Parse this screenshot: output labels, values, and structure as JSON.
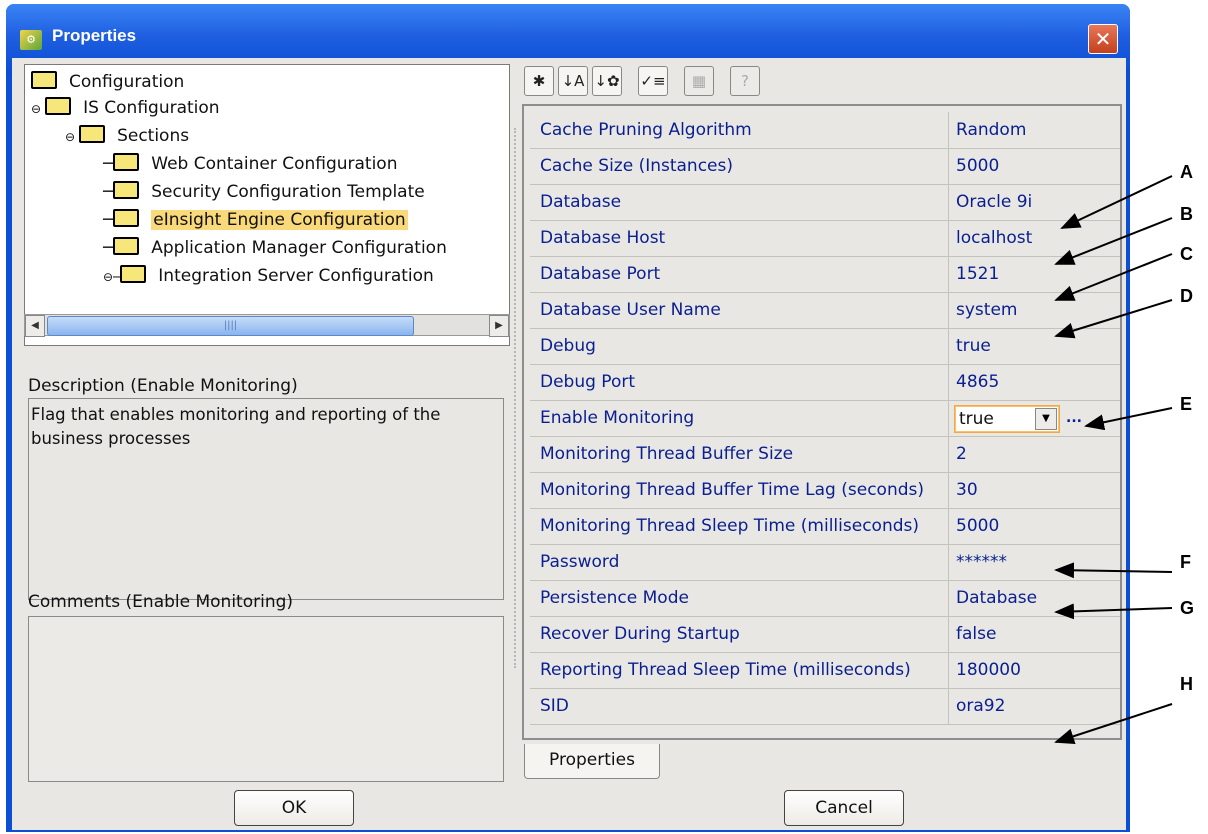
{
  "window": {
    "title": "Properties",
    "close_glyph": "✕"
  },
  "tree": {
    "nodes": [
      {
        "label": "Configuration"
      },
      {
        "label": "IS Configuration"
      },
      {
        "label": "Sections"
      },
      {
        "label": "Web Container Configuration"
      },
      {
        "label": "Security Configuration Template"
      },
      {
        "label": "eInsight Engine Configuration",
        "selected": true
      },
      {
        "label": "Application Manager Configuration"
      },
      {
        "label": "Integration Server Configuration"
      }
    ]
  },
  "description": {
    "label": "Description (Enable Monitoring)",
    "text": "Flag that enables monitoring and reporting of the business processes"
  },
  "comments": {
    "label": "Comments (Enable Monitoring)",
    "text": ""
  },
  "toolbar": {
    "icons": [
      "categorized-view-icon",
      "alphabetical-sort-icon",
      "sort-by-type-icon",
      "checklist-icon",
      "properties-grid-icon",
      "help-icon"
    ]
  },
  "properties": [
    {
      "name": "Cache Pruning Algorithm",
      "value": "Random"
    },
    {
      "name": "Cache Size (Instances)",
      "value": "5000"
    },
    {
      "name": "Database",
      "value": "Oracle 9i"
    },
    {
      "name": "Database Host",
      "value": "localhost"
    },
    {
      "name": "Database Port",
      "value": "1521"
    },
    {
      "name": "Database User Name",
      "value": "system"
    },
    {
      "name": "Debug",
      "value": "true"
    },
    {
      "name": "Debug Port",
      "value": "4865"
    },
    {
      "name": "Enable Monitoring",
      "value": "true"
    },
    {
      "name": "Monitoring Thread Buffer Size",
      "value": "2"
    },
    {
      "name": "Monitoring Thread Buffer Time Lag (seconds)",
      "value": "30"
    },
    {
      "name": "Monitoring Thread Sleep Time (milliseconds)",
      "value": "5000"
    },
    {
      "name": "Password",
      "value": "******"
    },
    {
      "name": "Persistence Mode",
      "value": "Database"
    },
    {
      "name": "Recover During Startup",
      "value": "false"
    },
    {
      "name": "Reporting Thread Sleep Time (milliseconds)",
      "value": "180000"
    },
    {
      "name": "SID",
      "value": "ora92"
    }
  ],
  "combo": {
    "ellipsis": "..."
  },
  "tab": {
    "label": "Properties"
  },
  "buttons": {
    "ok": "OK",
    "cancel": "Cancel"
  },
  "callouts": {
    "letters": [
      "A",
      "B",
      "C",
      "D",
      "E",
      "F",
      "G",
      "H"
    ]
  }
}
